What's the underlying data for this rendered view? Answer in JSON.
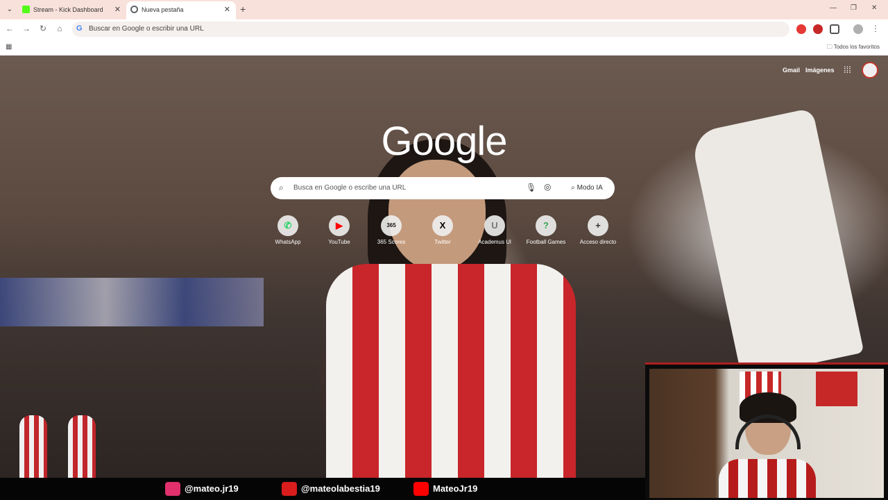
{
  "browser": {
    "tabs": [
      {
        "title": "Stream - Kick Dashboard",
        "active": false
      },
      {
        "title": "Nueva pestaña",
        "active": true
      }
    ],
    "omnibox_placeholder": "Buscar en Google o escribir una URL",
    "bookmarks_all": "Todos los favoritos"
  },
  "ntp": {
    "top_links": {
      "gmail": "Gmail",
      "images": "Imágenes"
    },
    "logo": "Google",
    "search": {
      "placeholder": "Busca en Google o escribe una URL",
      "ai_mode": "Modo IA"
    },
    "shortcuts": [
      {
        "label": "WhatsApp",
        "icon": "whatsapp-icon",
        "glyph": "✆",
        "color": "#25d366"
      },
      {
        "label": "YouTube",
        "icon": "youtube-icon",
        "glyph": "▶",
        "color": "#ff0000"
      },
      {
        "label": "365 Scores",
        "icon": "365scores-icon",
        "glyph": "365",
        "color": "#111111"
      },
      {
        "label": "Twitter",
        "icon": "x-twitter-icon",
        "glyph": "X",
        "color": "#000000"
      },
      {
        "label": "Academus Ul",
        "icon": "academus-icon",
        "glyph": "U",
        "color": "#777777"
      },
      {
        "label": "Football Games",
        "icon": "football-games-icon",
        "glyph": "?",
        "color": "#34a853"
      },
      {
        "label": "Acceso directo",
        "icon": "add-shortcut-icon",
        "glyph": "+",
        "color": "#333333"
      }
    ]
  },
  "overlay": {
    "socials": [
      {
        "handle": "@mateo.jr19",
        "icon": "instagram-icon",
        "color": "#e1306c"
      },
      {
        "handle": "@mateolabestia19",
        "icon": "x-icon",
        "color": "#d91c1c"
      },
      {
        "handle": "MateoJr19",
        "icon": "youtube-icon",
        "color": "#ff0000"
      }
    ]
  },
  "colors": {
    "accent_red": "#c8262a",
    "tab_strip": "#f8e1da"
  }
}
